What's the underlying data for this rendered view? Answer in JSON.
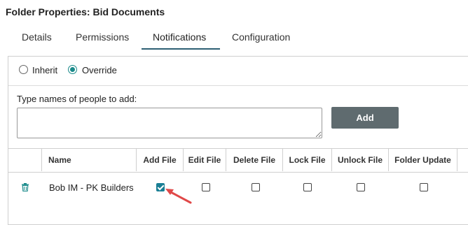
{
  "title": "Folder Properties: Bid Documents",
  "tabs": [
    {
      "label": "Details"
    },
    {
      "label": "Permissions"
    },
    {
      "label": "Notifications",
      "active": true
    },
    {
      "label": "Configuration"
    }
  ],
  "notification_mode": {
    "options": [
      {
        "label": "Inherit",
        "selected": false
      },
      {
        "label": "Override",
        "selected": true
      }
    ]
  },
  "people_input": {
    "label": "Type names of people to add:",
    "value": "",
    "add_button": "Add"
  },
  "table": {
    "columns": [
      "Name",
      "Add File",
      "Edit File",
      "Delete File",
      "Lock File",
      "Unlock File",
      "Folder Update"
    ],
    "rows": [
      {
        "name": "Bob IM - PK Builders",
        "add_file": true,
        "edit_file": false,
        "delete_file": false,
        "lock_file": false,
        "unlock_file": false,
        "folder_update": false
      }
    ]
  },
  "colors": {
    "accent": "#1a8a8a",
    "checkbox_checked": "#1a7f95",
    "add_button_bg": "#5f6b6f",
    "annotation_arrow": "#e04848",
    "tab_underline": "#2d5f73"
  },
  "icons": {
    "delete": "trash-icon",
    "annotation": "arrow-icon"
  }
}
